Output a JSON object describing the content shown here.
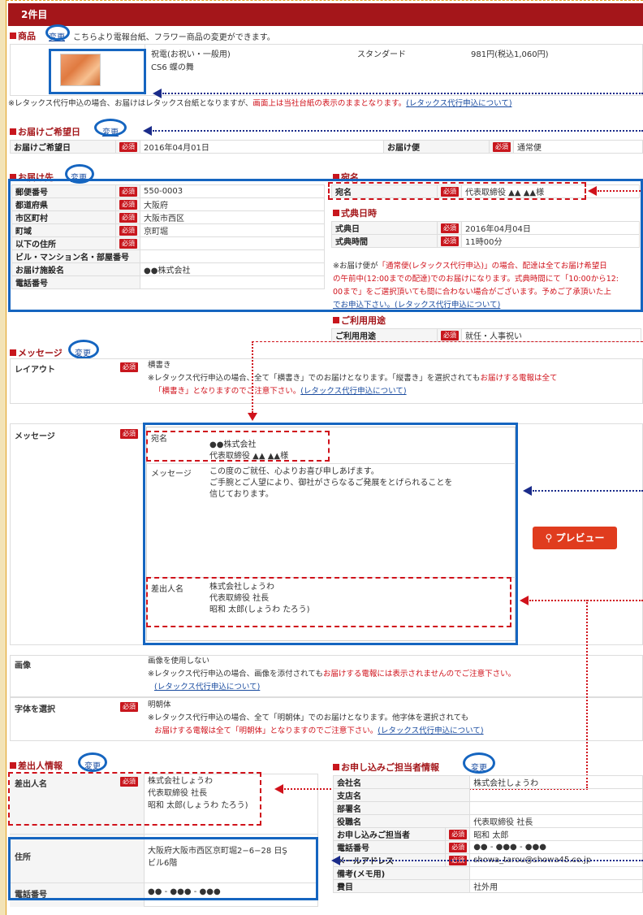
{
  "header": "2件目",
  "product": {
    "title": "商品",
    "change": "変更",
    "desc": "こちらより電報台紙、フラワー商品の変更ができます。",
    "category": "祝電(お祝い・一般用)",
    "name": "CS6 蝶の舞",
    "plan": "スタンダード",
    "price": "981円(税込1,060円)",
    "note_a": "※レタックス代行申込の場合、お届けはレタックス台紙となりますが、",
    "note_b": "画面上は当社台紙の表示のままとなります。",
    "note_link": "(レタックス代行申込について)"
  },
  "delivery": {
    "title": "お届けご希望日",
    "change": "変更",
    "date_label": "お届けご希望日",
    "date": "2016年04月01日",
    "method_label": "お届け便",
    "method": "通常便"
  },
  "required": "必須",
  "address": {
    "title": "お届け先",
    "change": "変更",
    "rows": [
      {
        "label": "郵便番号",
        "req": true,
        "value": "550-0003"
      },
      {
        "label": "都道府県",
        "req": true,
        "value": "大阪府"
      },
      {
        "label": "市区町村",
        "req": true,
        "value": "大阪市西区"
      },
      {
        "label": "町域",
        "req": true,
        "value": "京町堀"
      },
      {
        "label": "以下の住所",
        "req": true,
        "value": ""
      },
      {
        "label": "ビル・マンション名・部屋番号",
        "req": false,
        "value": ""
      },
      {
        "label": "お届け施設名",
        "req": false,
        "value": "●●株式会社"
      },
      {
        "label": "電話番号",
        "req": false,
        "value": ""
      }
    ]
  },
  "recipient": {
    "title": "宛名",
    "label": "宛名",
    "value": "代表取締役 ▲▲ ▲▲様"
  },
  "ceremony": {
    "title": "式典日時",
    "date_label": "式典日",
    "date": "2016年04月04日",
    "time_label": "式典時間",
    "time": "11時00分",
    "note_1": "※お届け便が",
    "note_2": "「通常便(レタックス代行申込)」の場合、配達は全てお届け希望日",
    "note_3": "の午前中(12:00までの配達)でのお届けになります。式典時間にて「10:00から12:",
    "note_4": "00まで」をご選択頂いても間に合わない場合がございます。予めご了承頂いた上",
    "note_5": "でお申込下さい。(レタックス代行申込について)"
  },
  "usage": {
    "title": "ご利用用途",
    "label": "ご利用用途",
    "value": "就任・人事祝い"
  },
  "message": {
    "title": "メッセージ",
    "change": "変更",
    "layout_label": "レイアウト",
    "layout": "横書き",
    "layout_note_1": "※レタックス代行申込の場合、全て「横書き」でのお届けとなります。「縦書き」を選択されても",
    "layout_note_2": "お届けする電報は全て",
    "layout_note_3": "「横書き」となりますのでご注意下さい。",
    "layout_link": "(レタックス代行申込について)",
    "msg_label": "メッセージ",
    "to_label": "宛名",
    "to_1": "●●株式会社",
    "to_2": "代表取締役 ▲▲ ▲▲様",
    "body_label": "メッセージ",
    "body_1": "この度のご就任、心よりお喜び申しあげます。",
    "body_2": "ご手腕とご人望により、御社がさらなるご発展をとげられることを",
    "body_3": "信じております。",
    "sender_label": "差出人名",
    "sender_1": "株式会社しょうわ",
    "sender_2": "代表取締役 社長",
    "sender_3": "昭和 太郎(しょうわ たろう)",
    "preview": "プレビュー",
    "image_label": "画像",
    "image": "画像を使用しない",
    "image_note_1": "※レタックス代行申込の場合、画像を添付されても",
    "image_note_2": "お届けする電報には表示されませんのでご注意下さい。",
    "image_link": "(レタックス代行申込について)",
    "font_label": "字体を選択",
    "font": "明朝体",
    "font_note_1": "※レタックス代行申込の場合、全て「明朝体」でのお届けとなります。他字体を選択されても",
    "font_note_2": "お届けする電報は全て「明朝体」となりますのでご注意下さい。",
    "font_link": "(レタックス代行申込について)"
  },
  "sender": {
    "title": "差出人情報",
    "change": "変更",
    "name_label": "差出人名",
    "name_1": "株式会社しょうわ",
    "name_2": "代表取締役 社長",
    "name_3": "昭和 太郎(しょうわ たろう)",
    "addr_label": "住所",
    "addr_1": "大阪府大阪市西区京町堀2−6−28 日Ş",
    "addr_2": "ビル6階",
    "tel_label": "電話番号",
    "tel": "●● - ●●● - ●●●"
  },
  "applicant": {
    "title": "お申し込みご担当者情報",
    "change": "変更",
    "rows": [
      {
        "label": "会社名",
        "req": false,
        "value": "株式会社しょうわ"
      },
      {
        "label": "支店名",
        "req": false,
        "value": ""
      },
      {
        "label": "部署名",
        "req": false,
        "value": ""
      },
      {
        "label": "役職名",
        "req": false,
        "value": "代表取締役 社長"
      },
      {
        "label": "お申し込みご担当者",
        "req": true,
        "value": "昭和 太郎"
      },
      {
        "label": "電話番号",
        "req": true,
        "value": "●● - ●●● - ●●●"
      },
      {
        "label": "メールアドレス",
        "req": true,
        "value": "showa_tarou@showa45.co.jp"
      },
      {
        "label": "備考(メモ用)",
        "req": false,
        "value": ""
      },
      {
        "label": "費目",
        "req": false,
        "value": "社外用"
      }
    ]
  }
}
